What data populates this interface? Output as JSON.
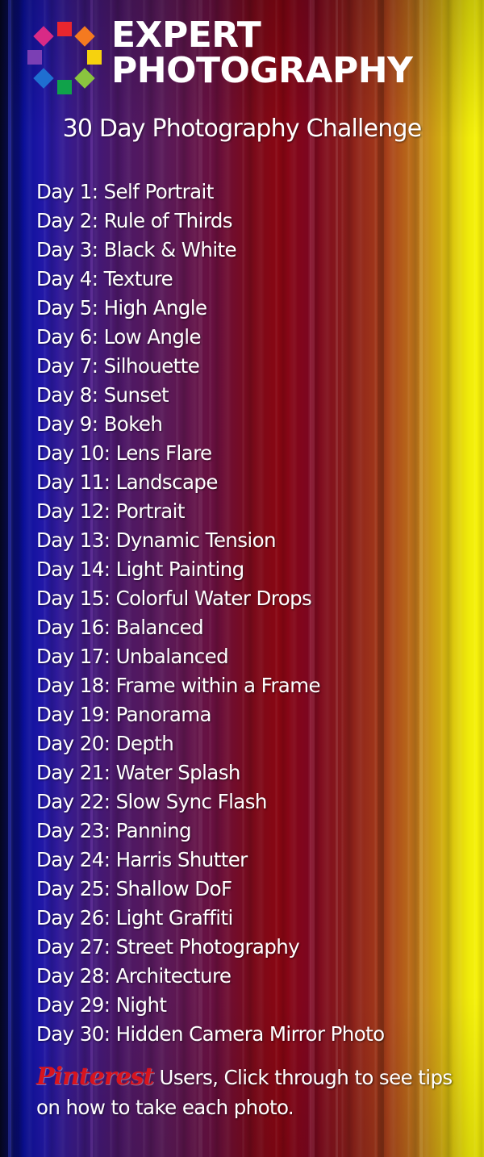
{
  "brand": {
    "line1": "EXPERT",
    "line2": "PHOTOGRAPHY"
  },
  "subtitle": "30 Day Photography Challenge",
  "days": [
    "Day 1: Self Portrait",
    "Day 2: Rule of Thirds",
    "Day 3: Black & White",
    "Day 4: Texture",
    "Day 5: High Angle",
    "Day 6: Low Angle",
    "Day 7: Silhouette",
    "Day 8: Sunset",
    "Day 9: Bokeh",
    "Day 10: Lens Flare",
    "Day 11: Landscape",
    "Day 12: Portrait",
    "Day 13: Dynamic Tension",
    "Day 14: Light Painting",
    "Day 15: Colorful Water Drops",
    "Day 16: Balanced",
    "Day 17: Unbalanced",
    "Day 18: Frame within a Frame",
    "Day 19: Panorama",
    "Day 20: Depth",
    "Day 21: Water Splash",
    "Day 22: Slow Sync Flash",
    "Day 23: Panning",
    "Day 24: Harris Shutter",
    "Day 25: Shallow DoF",
    "Day 26: Light Graffiti",
    "Day 27: Street Photography",
    "Day 28: Architecture",
    "Day 29: Night",
    "Day 30: Hidden Camera Mirror Photo"
  ],
  "footer": {
    "brand": "Pinterest",
    "text": " Users, Click through to see tips on how to take each photo."
  },
  "colors": {
    "pinterest_red": "#d8141e",
    "logo_squares": [
      "#e8262e",
      "#f47a20",
      "#f6d20e",
      "#8ac43f",
      "#10a24a",
      "#1f6fd1",
      "#7b3fb4",
      "#d92a86"
    ]
  },
  "icons": {
    "logo": "expert-photography-logo-icon"
  }
}
